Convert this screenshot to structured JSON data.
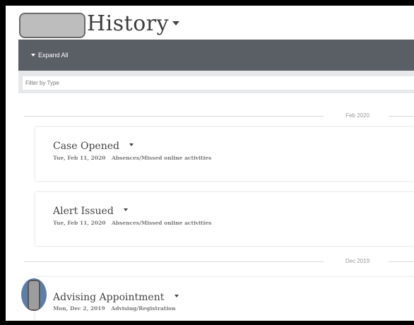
{
  "header": {
    "title": "History"
  },
  "toolbar": {
    "expand_all_label": "Expand All"
  },
  "filter": {
    "placeholder": "Filter by Type",
    "value": ""
  },
  "timeline": {
    "groups": [
      {
        "date_label": "Feb 2020",
        "items": [
          {
            "title": "Case Opened",
            "date": "Tue, Feb 11, 2020",
            "category": "Absences/Missed online activities"
          },
          {
            "title": "Alert Issued",
            "date": "Tue, Feb 11, 2020",
            "category": "Absences/Missed online activities"
          }
        ]
      },
      {
        "date_label": "Dec 2019",
        "items": [
          {
            "title": "Advising Appointment",
            "date": "Mon, Dec 2, 2019",
            "category": "Advising/Registration"
          }
        ]
      }
    ]
  },
  "colors": {
    "toolbar_bg": "#5a5f66",
    "filter_bg": "#e7e8ea",
    "avatar_bg": "#5d7ea8"
  }
}
